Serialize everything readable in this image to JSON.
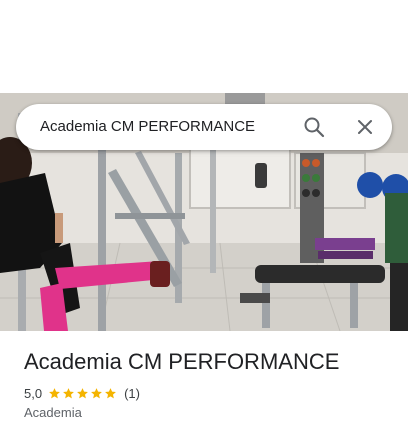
{
  "search": {
    "query": "Academia CM PERFORMANCE"
  },
  "place": {
    "name": "Academia CM PERFORMANCE",
    "rating": "5,0",
    "stars": 5,
    "review_count": "(1)",
    "category": "Academia"
  },
  "icons": {
    "search": "search-icon",
    "close": "close-icon",
    "star": "star-icon"
  },
  "colors": {
    "star": "#f4b400",
    "text_primary": "#202124",
    "text_secondary": "#5f6368"
  }
}
